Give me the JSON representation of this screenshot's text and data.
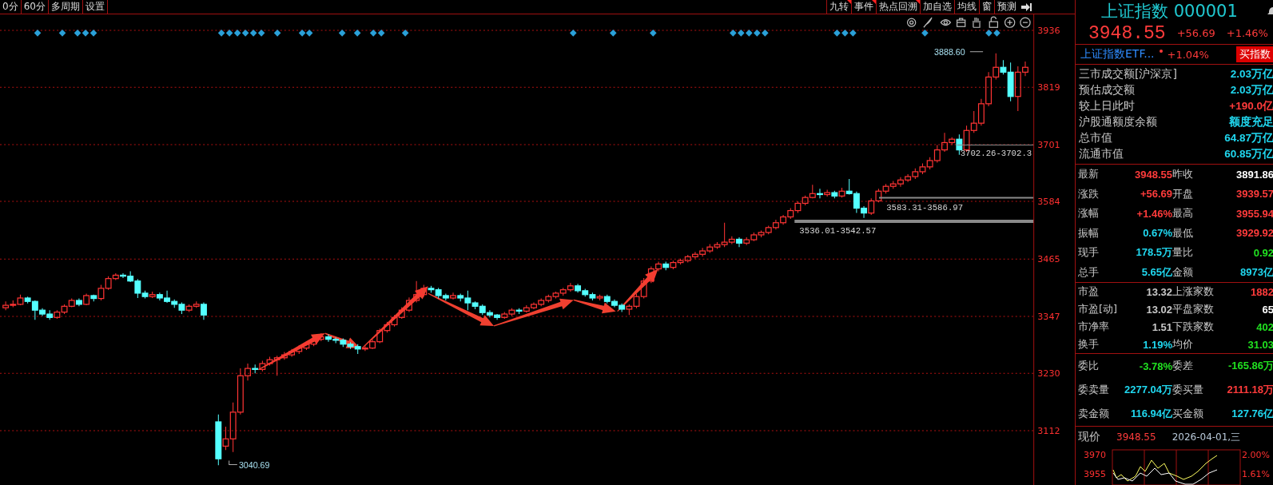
{
  "top_bar": {
    "left_tabs": [
      "0分",
      "60分",
      "多周期",
      "设置"
    ],
    "right_tabs": [
      {
        "label": "九转",
        "flagged": true
      },
      {
        "label": "事件",
        "flagged": true
      },
      {
        "label": "热点回溯",
        "flagged": true
      },
      {
        "label": "加自选",
        "flagged": false
      },
      {
        "label": "均线",
        "flagged": false
      },
      {
        "label": "窗",
        "flagged": false
      },
      {
        "label": "预测",
        "flagged": false
      }
    ]
  },
  "chart": {
    "chart_data": {
      "type": "candlestick",
      "ylim": [
        3000,
        3969
      ],
      "yticks": [
        3936,
        3819,
        3701,
        3584,
        3465,
        3347,
        3230,
        3112
      ],
      "ohlc": [
        [
          3365,
          3378,
          3360,
          3370
        ],
        [
          3370,
          3380,
          3366,
          3372
        ],
        [
          3372,
          3392,
          3370,
          3385
        ],
        [
          3385,
          3388,
          3374,
          3378
        ],
        [
          3378,
          3380,
          3340,
          3360
        ],
        [
          3360,
          3364,
          3348,
          3352
        ],
        [
          3352,
          3360,
          3340,
          3345
        ],
        [
          3345,
          3360,
          3342,
          3356
        ],
        [
          3356,
          3372,
          3352,
          3368
        ],
        [
          3368,
          3384,
          3366,
          3380
        ],
        [
          3380,
          3384,
          3368,
          3372
        ],
        [
          3372,
          3394,
          3370,
          3390
        ],
        [
          3390,
          3392,
          3378,
          3384
        ],
        [
          3384,
          3412,
          3380,
          3405
        ],
        [
          3405,
          3430,
          3402,
          3425
        ],
        [
          3425,
          3436,
          3422,
          3432
        ],
        [
          3432,
          3436,
          3426,
          3430
        ],
        [
          3430,
          3440,
          3418,
          3420
        ],
        [
          3420,
          3424,
          3385,
          3395
        ],
        [
          3395,
          3400,
          3384,
          3388
        ],
        [
          3388,
          3398,
          3385,
          3392
        ],
        [
          3392,
          3396,
          3380,
          3385
        ],
        [
          3385,
          3400,
          3375,
          3378
        ],
        [
          3378,
          3382,
          3365,
          3372
        ],
        [
          3372,
          3376,
          3352,
          3360
        ],
        [
          3360,
          3372,
          3356,
          3368
        ],
        [
          3368,
          3378,
          3365,
          3372
        ],
        [
          3372,
          3376,
          3340,
          3350
        ],
        null,
        [
          3130,
          3145,
          3040.69,
          3054
        ],
        [
          3080,
          3120,
          3072,
          3095
        ],
        [
          3095,
          3170,
          3068,
          3150
        ],
        [
          3150,
          3240,
          3145,
          3225
        ],
        [
          3225,
          3250,
          3215,
          3240
        ],
        [
          3240,
          3248,
          3230,
          3238
        ],
        [
          3238,
          3256,
          3234,
          3250
        ],
        [
          3250,
          3264,
          3246,
          3258
        ],
        [
          3258,
          3266,
          3225,
          3262
        ],
        [
          3262,
          3274,
          3258,
          3268
        ],
        [
          3268,
          3280,
          3264,
          3275
        ],
        [
          3275,
          3288,
          3270,
          3282
        ],
        [
          3282,
          3296,
          3278,
          3290
        ],
        [
          3290,
          3306,
          3286,
          3300
        ],
        [
          3300,
          3312,
          3296,
          3305
        ],
        [
          3305,
          3310,
          3295,
          3300
        ],
        [
          3300,
          3304,
          3292,
          3298
        ],
        [
          3298,
          3302,
          3284,
          3290
        ],
        [
          3290,
          3294,
          3280,
          3285
        ],
        [
          3285,
          3290,
          3270,
          3280
        ],
        [
          3280,
          3288,
          3276,
          3282
        ],
        [
          3282,
          3300,
          3280,
          3295
        ],
        [
          3295,
          3322,
          3292,
          3318
        ],
        [
          3318,
          3336,
          3314,
          3330
        ],
        [
          3330,
          3350,
          3326,
          3345
        ],
        [
          3345,
          3366,
          3342,
          3360
        ],
        [
          3360,
          3386,
          3356,
          3380
        ],
        [
          3380,
          3420,
          3376,
          3392
        ],
        [
          3392,
          3412,
          3388,
          3405
        ],
        [
          3405,
          3410,
          3396,
          3402
        ],
        [
          3402,
          3406,
          3384,
          3390
        ],
        [
          3390,
          3394,
          3380,
          3385
        ],
        [
          3385,
          3396,
          3382,
          3390
        ],
        [
          3390,
          3394,
          3378,
          3385
        ],
        [
          3385,
          3400,
          3360,
          3375
        ],
        [
          3375,
          3378,
          3362,
          3368
        ],
        [
          3368,
          3372,
          3350,
          3355
        ],
        [
          3355,
          3360,
          3345,
          3350
        ],
        [
          3350,
          3352,
          3340,
          3345
        ],
        [
          3345,
          3356,
          3342,
          3352
        ],
        [
          3352,
          3364,
          3348,
          3360
        ],
        [
          3360,
          3364,
          3352,
          3358
        ],
        [
          3358,
          3370,
          3355,
          3365
        ],
        [
          3365,
          3376,
          3362,
          3372
        ],
        [
          3372,
          3384,
          3368,
          3380
        ],
        [
          3380,
          3392,
          3376,
          3388
        ],
        [
          3388,
          3398,
          3384,
          3395
        ],
        [
          3395,
          3406,
          3390,
          3402
        ],
        [
          3402,
          3416,
          3398,
          3410
        ],
        [
          3410,
          3414,
          3396,
          3400
        ],
        [
          3400,
          3404,
          3388,
          3392
        ],
        [
          3392,
          3396,
          3380,
          3385
        ],
        [
          3385,
          3392,
          3380,
          3388
        ],
        [
          3388,
          3392,
          3374,
          3378
        ],
        [
          3378,
          3382,
          3366,
          3370
        ],
        [
          3370,
          3374,
          3356,
          3362
        ],
        [
          3362,
          3372,
          3350,
          3368
        ],
        [
          3368,
          3394,
          3364,
          3388
        ],
        [
          3388,
          3426,
          3384,
          3420
        ],
        [
          3420,
          3450,
          3416,
          3445
        ],
        [
          3445,
          3460,
          3440,
          3455
        ],
        [
          3455,
          3460,
          3442,
          3448
        ],
        [
          3448,
          3462,
          3444,
          3458
        ],
        [
          3458,
          3466,
          3454,
          3462
        ],
        [
          3462,
          3474,
          3458,
          3470
        ],
        [
          3470,
          3480,
          3466,
          3475
        ],
        [
          3475,
          3488,
          3470,
          3482
        ],
        [
          3482,
          3496,
          3478,
          3490
        ],
        [
          3490,
          3500,
          3486,
          3495
        ],
        [
          3495,
          3540,
          3490,
          3500
        ],
        [
          3500,
          3512,
          3496,
          3506
        ],
        [
          3506,
          3510,
          3490,
          3498
        ],
        [
          3498,
          3510,
          3494,
          3505
        ],
        [
          3505,
          3520,
          3502,
          3515
        ],
        [
          3515,
          3524,
          3510,
          3520
        ],
        [
          3520,
          3534,
          3516,
          3530
        ],
        [
          3530,
          3546,
          3526,
          3540
        ],
        [
          3540,
          3556,
          3536,
          3552
        ],
        [
          3552,
          3570,
          3548,
          3565
        ],
        [
          3565,
          3584,
          3560,
          3580
        ],
        [
          3580,
          3596,
          3576,
          3592
        ],
        [
          3592,
          3618,
          3590,
          3600
        ],
        [
          3600,
          3610,
          3590,
          3598
        ],
        [
          3598,
          3608,
          3594,
          3602
        ],
        [
          3602,
          3606,
          3590,
          3595
        ],
        [
          3595,
          3612,
          3592,
          3605
        ],
        [
          3605,
          3630,
          3598,
          3600
        ],
        [
          3600,
          3604,
          3560,
          3570
        ],
        [
          3570,
          3574,
          3550,
          3560
        ],
        [
          3560,
          3590,
          3556,
          3585
        ],
        [
          3585,
          3610,
          3582,
          3605
        ],
        [
          3605,
          3620,
          3600,
          3615
        ],
        [
          3615,
          3626,
          3610,
          3620
        ],
        [
          3620,
          3634,
          3614,
          3628
        ],
        [
          3628,
          3640,
          3624,
          3635
        ],
        [
          3635,
          3652,
          3630,
          3645
        ],
        [
          3645,
          3662,
          3640,
          3655
        ],
        [
          3655,
          3675,
          3650,
          3668
        ],
        [
          3668,
          3700,
          3664,
          3690
        ],
        [
          3690,
          3725,
          3686,
          3705
        ],
        [
          3705,
          3716,
          3700,
          3712
        ],
        [
          3712,
          3722,
          3680,
          3690
        ],
        [
          3690,
          3740,
          3686,
          3730
        ],
        [
          3730,
          3770,
          3725,
          3745
        ],
        [
          3745,
          3795,
          3740,
          3785
        ],
        [
          3785,
          3850,
          3780,
          3840
        ],
        [
          3840,
          3888.6,
          3835,
          3860
        ],
        [
          3860,
          3875,
          3845,
          3850
        ],
        [
          3850,
          3870,
          3790,
          3800
        ],
        [
          3800,
          3862,
          3770,
          3850
        ],
        [
          3850,
          3872,
          3842,
          3860
        ]
      ],
      "grid": true
    },
    "high_label": "3888.60",
    "low_label": "3040.69",
    "ranges": [
      "3702.26-3702.3",
      "3583.31-3586.97",
      "3536.01-3542.57"
    ]
  },
  "quote": {
    "title": "上证指数 000001",
    "price": "3948.55",
    "change": "+56.69",
    "change_pct": "+1.46%"
  },
  "etf": {
    "name": "上证指数ETF...",
    "change": "+1.04%",
    "button": "买指数"
  },
  "turnover": [
    {
      "label": "三市成交额[沪深京]",
      "value": "2.03万亿",
      "color": "#20d8f0"
    },
    {
      "label": "预估成交额",
      "value": "2.03万亿",
      "color": "#20d8f0"
    },
    {
      "label": "较上日此时",
      "value": "+190.0亿",
      "color": "#ff3b3b"
    },
    {
      "label": "沪股通额度余额",
      "value": "额度充足",
      "color": "#20d8f0"
    },
    {
      "label": "总市值",
      "value": "64.87万亿",
      "color": "#20d8f0"
    },
    {
      "label": "流通市值",
      "value": "60.85万亿",
      "color": "#20d8f0"
    }
  ],
  "stat_groups": [
    [
      {
        "label": "最新",
        "value": "3948.55",
        "color": "#ff3b3b"
      },
      {
        "label": "昨收",
        "value": "3891.86",
        "color": "#ffffff"
      },
      {
        "label": "涨跌",
        "value": "+56.69",
        "color": "#ff3b3b"
      },
      {
        "label": "开盘",
        "value": "3939.57",
        "color": "#ff3b3b"
      },
      {
        "label": "涨幅",
        "value": "+1.46%",
        "color": "#ff3b3b"
      },
      {
        "label": "最高",
        "value": "3955.94",
        "color": "#ff3b3b"
      },
      {
        "label": "振幅",
        "value": "0.67%",
        "color": "#20d8f0"
      },
      {
        "label": "最低",
        "value": "3929.92",
        "color": "#ff3b3b"
      },
      {
        "label": "现手",
        "value": "178.5万",
        "color": "#20d8f0"
      },
      {
        "label": "量比",
        "value": "0.92",
        "color": "#20e020"
      },
      {
        "label": "总手",
        "value": "5.65亿",
        "color": "#20d8f0"
      },
      {
        "label": "金额",
        "value": "8973亿",
        "color": "#20d8f0"
      }
    ],
    [
      {
        "label": "市盈",
        "value": "13.32",
        "color": "#c8c8c8"
      },
      {
        "label": "上涨家数",
        "value": "1882",
        "color": "#ff3b3b"
      },
      {
        "label": "市盈[动]",
        "value": "13.02",
        "color": "#c8c8c8"
      },
      {
        "label": "平盘家数",
        "value": "65",
        "color": "#ffffff"
      },
      {
        "label": "市净率",
        "value": "1.51",
        "color": "#c8c8c8"
      },
      {
        "label": "下跌家数",
        "value": "402",
        "color": "#20e020"
      },
      {
        "label": "换手",
        "value": "1.19%",
        "color": "#20d8f0"
      },
      {
        "label": "均价",
        "value": "31.03",
        "color": "#20e020"
      }
    ],
    [
      {
        "label": "委比",
        "value": "-3.78%",
        "color": "#20e020"
      },
      {
        "label": "委差",
        "value": "-165.86万",
        "color": "#20e020"
      },
      {
        "label": "委卖量",
        "value": "2277.04万",
        "color": "#20d8f0"
      },
      {
        "label": "委买量",
        "value": "2111.18万",
        "color": "#ff3b3b"
      },
      {
        "label": "卖金额",
        "value": "116.94亿",
        "color": "#20d8f0"
      },
      {
        "label": "买金额",
        "value": "127.76亿",
        "color": "#20d8f0"
      }
    ]
  ],
  "now": {
    "label": "现价",
    "price": "3948.55",
    "date": "2026-04-01,三"
  },
  "mini_chart": {
    "left_labels": [
      "3970",
      "3955"
    ],
    "right_labels": [
      "2.00%",
      "1.61%"
    ]
  }
}
